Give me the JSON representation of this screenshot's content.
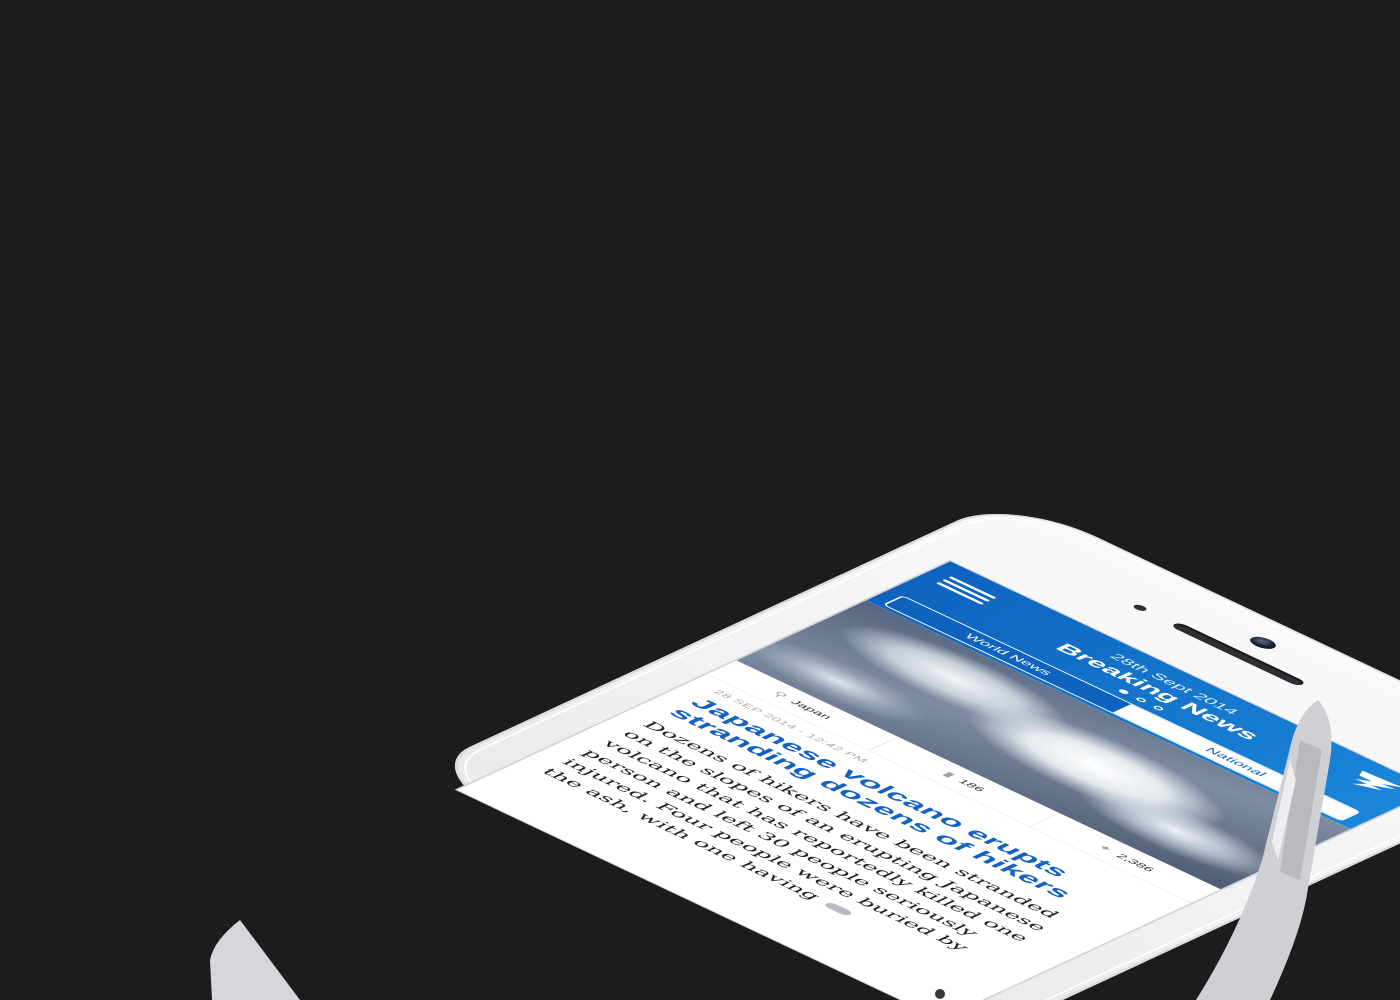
{
  "header": {
    "date": "28th Sept 2014",
    "title": "Breaking News",
    "tabs": [
      {
        "label": "World News",
        "active": true
      },
      {
        "label": "National",
        "active": false
      }
    ],
    "pages": 3,
    "active_page": 1
  },
  "article": {
    "image": "volcano-eruption-photo",
    "location": "Japan",
    "comments": "186",
    "tweets": "2,386",
    "date": "28 SEP 2014 - 12:42 PM",
    "headline": "Japanese volcano erupts stranding dozens of hikers",
    "body": "Dozens of hikers have been stranded on the slopes of an erupting Japanese volcano that has reportedly killed one person and left 30 people seriously injured. Four people were buried by the ash, with one having"
  },
  "colors": {
    "background": "#1c1c1d",
    "header_blue": "#0e63bf",
    "header_blue_light": "#1a86d9",
    "headline": "#1362c3"
  }
}
